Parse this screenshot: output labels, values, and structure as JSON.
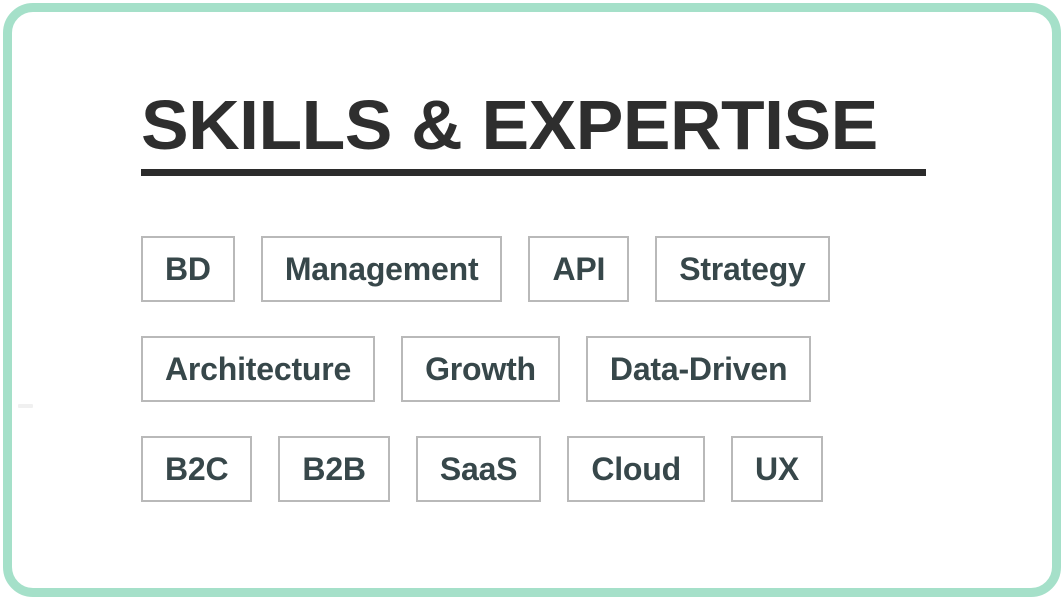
{
  "frame": {
    "border_color": "#a5e0c9",
    "background": "#ffffff",
    "corner_radius_px": "30"
  },
  "header": {
    "title": "SKILLS & EXPERTISE",
    "title_color": "#2e2e2e",
    "rule_color": "#2b2b2b"
  },
  "skills": {
    "tag_border_color": "#b9b9b9",
    "tag_text_color": "#37474a",
    "rows": [
      {
        "tags": [
          {
            "label": "BD"
          },
          {
            "label": "Management"
          },
          {
            "label": "API"
          },
          {
            "label": "Strategy"
          }
        ]
      },
      {
        "tags": [
          {
            "label": "Architecture"
          },
          {
            "label": "Growth"
          },
          {
            "label": "Data-Driven"
          }
        ]
      },
      {
        "tags": [
          {
            "label": "B2C"
          },
          {
            "label": "B2B"
          },
          {
            "label": "SaaS"
          },
          {
            "label": "Cloud"
          },
          {
            "label": "UX"
          }
        ]
      }
    ]
  }
}
